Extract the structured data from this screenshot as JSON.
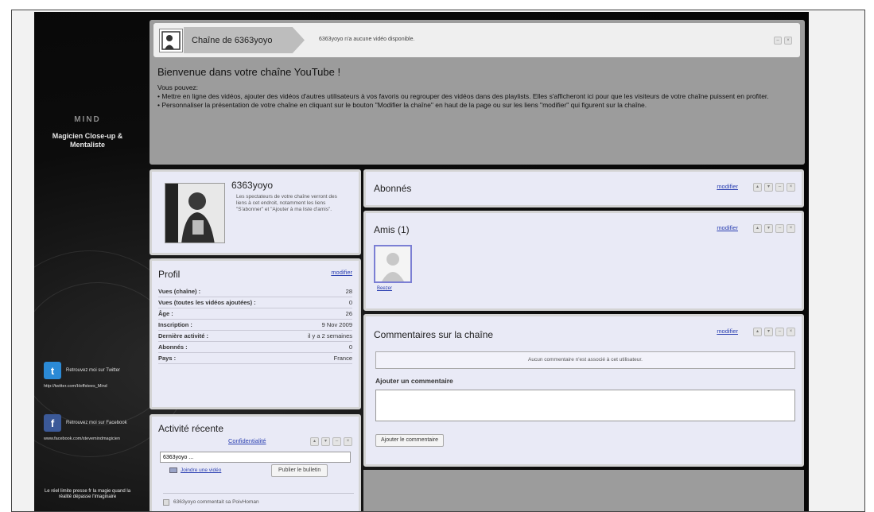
{
  "sidebar": {
    "brand_logo": "MIND",
    "brand_name": "Magicien Close-up & Mentaliste",
    "twitter": {
      "text": "Retrouvez moi sur Twitter",
      "url": "http://twitter.com/Hoffstees_Mind"
    },
    "facebook": {
      "text": "Retrouvez moi sur Facebook",
      "url": "www.facebook.com/stevemindmagicien"
    },
    "tagline": "Le réel limite presse fr la magie quand la réalité dépasse l'imaginaire"
  },
  "header": {
    "channel_title": "Chaîne de 6363yoyo",
    "no_video": "6363yoyo n'a aucune vidéo disponible."
  },
  "welcome": {
    "title": "Bienvenue dans votre chaîne YouTube !",
    "intro": "Vous pouvez:",
    "line1": "• Mettre en ligne des vidéos, ajouter des vidéos d'autres utilisateurs à vos favoris ou regrouper des vidéos dans des playlists. Elles s'afficheront ici pour que les visiteurs de votre chaîne puissent en profiter.",
    "line2": "• Personnaliser la présentation de votre chaîne en cliquant sur le bouton \"Modifier la chaîne\" en haut de la page ou sur les liens \"modifier\" qui figurent sur la chaîne."
  },
  "user": {
    "name": "6363yoyo",
    "note": "Les spectateurs de votre chaîne verront des liens à cet endroit, notamment les liens \"S'abonner\" et \"Ajouter à ma liste d'amis\"."
  },
  "profile": {
    "title": "Profil",
    "edit": "modifier",
    "rows": [
      {
        "label": "Vues (chaîne) :",
        "value": "28"
      },
      {
        "label": "Vues (toutes les vidéos ajoutées) :",
        "value": "0"
      },
      {
        "label": "Âge :",
        "value": "26"
      },
      {
        "label": "Inscription :",
        "value": "9 Nov 2009"
      },
      {
        "label": "Dernière activité :",
        "value": "il y a 2 semaines"
      },
      {
        "label": "Abonnés :",
        "value": "0"
      },
      {
        "label": "Pays :",
        "value": "France"
      }
    ]
  },
  "activity": {
    "title": "Activité récente",
    "privacy": "Confidentialité",
    "input_value": "6363yoyo ...",
    "join_video": "Joindre une vidéo",
    "publish": "Publier le bulletin",
    "item": "6363yoyo commentait sa PoivHoman"
  },
  "subscribers": {
    "title": "Abonnés",
    "edit": "modifier"
  },
  "friends": {
    "title": "Amis (1)",
    "edit": "modifier",
    "friend_name": "Beezer"
  },
  "comments": {
    "title": "Commentaires sur la chaîne",
    "edit": "modifier",
    "empty": "Aucun commentaire n'est associé à cet utilisateur.",
    "add_label": "Ajouter un commentaire",
    "submit": "Ajouter le commentaire"
  }
}
